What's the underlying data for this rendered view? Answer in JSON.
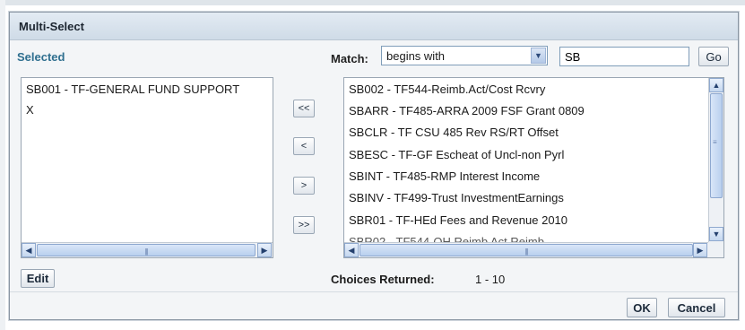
{
  "dialog": {
    "title": "Multi-Select",
    "selected_label": "Selected",
    "match_label": "Match:",
    "match_mode": "begins with",
    "search_value": "SB",
    "go_label": "Go",
    "edit_label": "Edit",
    "choices_label": "Choices Returned:",
    "choices_range": "1 - 10",
    "ok_label": "OK",
    "cancel_label": "Cancel"
  },
  "selected_items": [
    "SB001 - TF-GENERAL FUND SUPPORT",
    "X"
  ],
  "available_items": [
    "SB002 - TF544-Reimb.Act/Cost Rcvry",
    "SBARR - TF485-ARRA 2009 FSF Grant 0809",
    "SBCLR - TF CSU 485 Rev RS/RT Offset",
    "SBESC - TF-GF Escheat of Uncl-non Pyrl",
    "SBINT - TF485-RMP Interest Income",
    "SBINV - TF499-Trust InvestmentEarnings",
    "SBR01 - TF-HEd Fees and Revenue 2010"
  ],
  "move_buttons": {
    "remove_all": "<<",
    "remove": "<",
    "add": ">",
    "add_all": ">>"
  },
  "icons": {
    "dropdown": "chevron-down-icon",
    "scroll_left": "arrow-left-icon",
    "scroll_right": "arrow-right-icon",
    "scroll_up": "arrow-up-icon",
    "scroll_down": "arrow-down-icon",
    "scroll_grip": "grip-icon"
  }
}
